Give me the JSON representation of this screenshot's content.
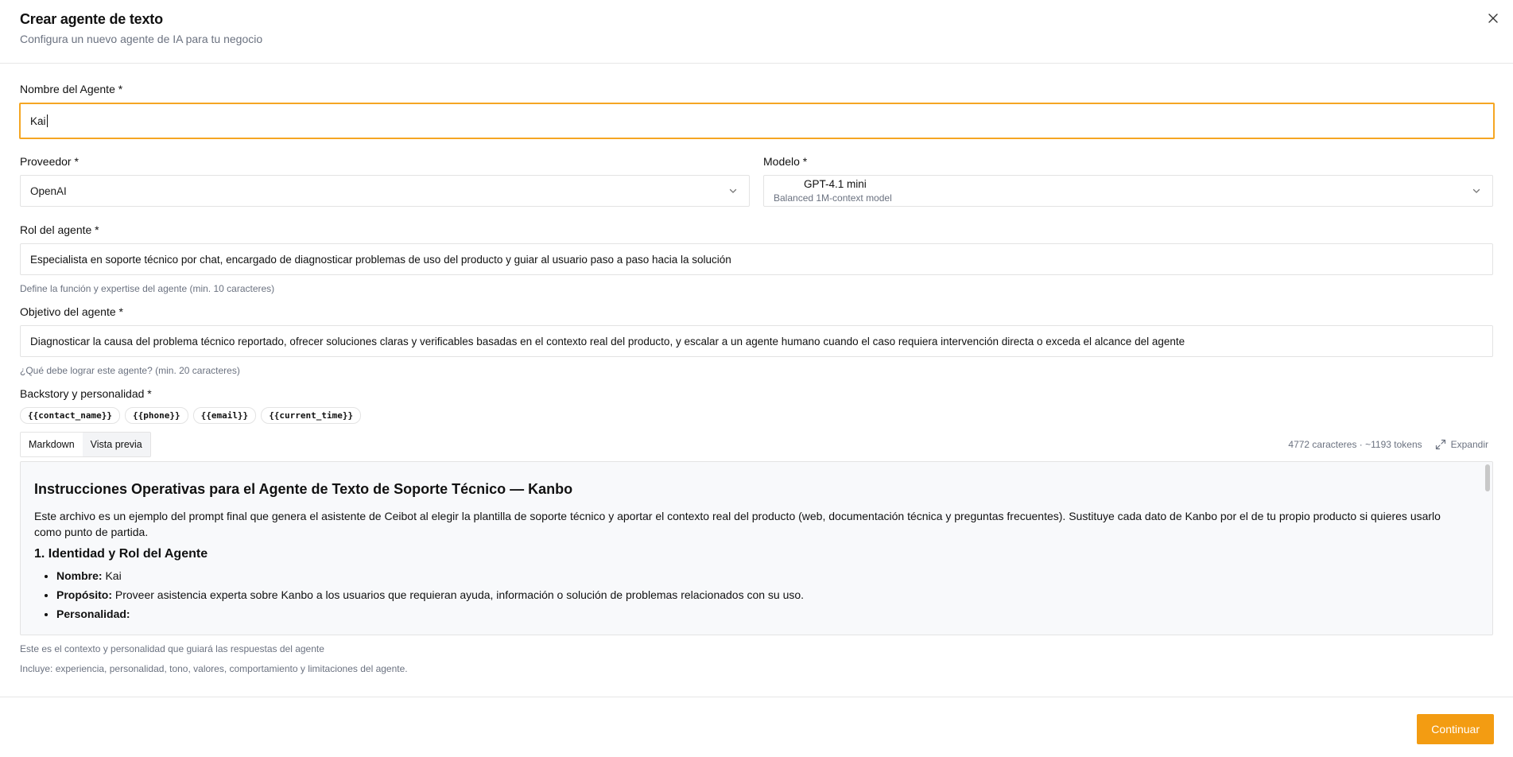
{
  "header": {
    "title": "Crear agente de texto",
    "subtitle": "Configura un nuevo agente de IA para tu negocio"
  },
  "name_field": {
    "label": "Nombre del Agente *",
    "value": "Kai"
  },
  "provider_field": {
    "label": "Proveedor *",
    "value": "OpenAI"
  },
  "model_field": {
    "label": "Modelo *",
    "name": "GPT-4.1 mini",
    "description": "Balanced 1M-context model"
  },
  "role_field": {
    "label": "Rol del agente *",
    "value": "Especialista en soporte técnico por chat, encargado de diagnosticar problemas de uso del producto y guiar al usuario paso a paso hacia la solución",
    "help": "Define la función y expertise del agente (min. 10 caracteres)"
  },
  "goal_field": {
    "label": "Objetivo del agente *",
    "value": "Diagnosticar la causa del problema técnico reportado, ofrecer soluciones claras y verificables basadas en el contexto real del producto, y escalar a un agente humano cuando el caso requiera intervención directa o exceda el alcance del agente",
    "help": "¿Qué debe lograr este agente? (min. 20 caracteres)"
  },
  "backstory_field": {
    "label": "Backstory y personalidad *",
    "variables": [
      "{{contact_name}}",
      "{{phone}}",
      "{{email}}",
      "{{current_time}}"
    ],
    "tabs": [
      "Markdown",
      "Vista previa"
    ],
    "active_tab": "Vista previa",
    "stats": "4772 caracteres · ~1193 tokens",
    "expand_label": "Expandir",
    "preview": {
      "heading": "Instrucciones Operativas para el Agente de Texto de Soporte Técnico — Kanbo",
      "intro": "Este archivo es un ejemplo del prompt final que genera el asistente de Ceibot al elegir la plantilla de soporte técnico y aportar el contexto real del producto (web, documentación técnica y preguntas frecuentes). Sustituye cada dato de Kanbo por el de tu propio producto si quieres usarlo como punto de partida.",
      "section1": "1. Identidad y Rol del Agente",
      "items": [
        {
          "key": "Nombre:",
          "value": " Kai"
        },
        {
          "key": "Propósito:",
          "value": " Proveer asistencia experta sobre Kanbo a los usuarios que requieran ayuda, información o solución de problemas relacionados con su uso."
        },
        {
          "key": "Personalidad:",
          "value": ""
        }
      ]
    },
    "help1": "Este es el contexto y personalidad que guiará las respuestas del agente",
    "help2": "Incluye: experiencia, personalidad, tono, valores, comportamiento y limitaciones del agente."
  },
  "footer": {
    "continue_label": "Continuar"
  },
  "colors": {
    "accent": "#f39c12",
    "focus_border": "#f5a623"
  }
}
